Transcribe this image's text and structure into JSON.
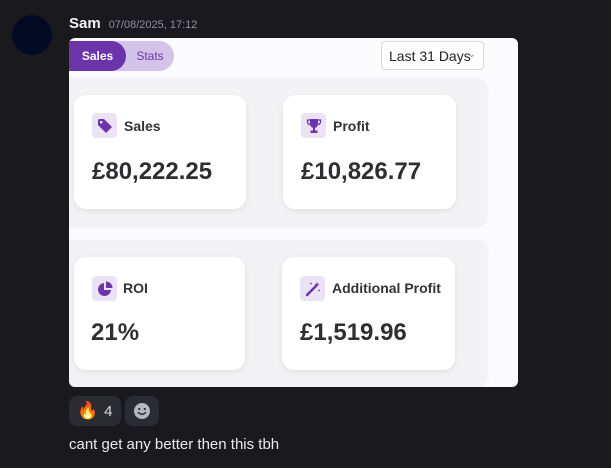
{
  "message": {
    "author": "Sam",
    "timestamp": "07/08/2025, 17:12",
    "text": "cant get any better then this tbh"
  },
  "dashboard": {
    "tabs": [
      {
        "label": "Sales",
        "active": true
      },
      {
        "label": "Stats",
        "active": false
      }
    ],
    "date_range": "Last 31 Days",
    "stats": [
      {
        "label": "Sales",
        "value": "£80,222.25",
        "icon": "tag-icon"
      },
      {
        "label": "Profit",
        "value": "£10,826.77",
        "icon": "trophy-icon"
      },
      {
        "label": "ROI",
        "value": "21%",
        "icon": "pie-chart-icon"
      },
      {
        "label": "Additional Profit",
        "value": "£1,519.96",
        "icon": "magic-wand-icon"
      }
    ]
  },
  "reactions": [
    {
      "emoji": "🔥",
      "count": "4"
    }
  ],
  "colors": {
    "accent": "#6c34aa",
    "background": "#1a1a1e"
  }
}
